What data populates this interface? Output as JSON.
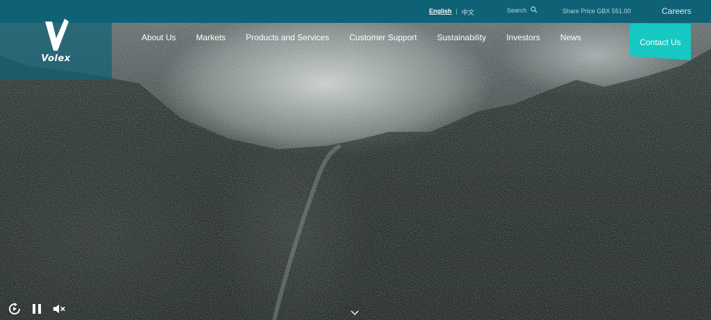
{
  "brand": {
    "name": "Volex"
  },
  "topbar": {
    "lang_active": "English",
    "lang_sep": "|",
    "lang_alt": "中文",
    "search_label": "Search",
    "share_price": "Share Price GBX 551.00",
    "careers": "Careers"
  },
  "nav": {
    "items": [
      "About Us",
      "Markets",
      "Products and Services",
      "Customer Support",
      "Sustainability",
      "Investors",
      "News"
    ],
    "contact": "Contact Us"
  },
  "colors": {
    "topbar": "#0f6276",
    "accent": "#17c7c1"
  },
  "icons": {
    "search": "search-icon",
    "replay": "replay-icon",
    "pause": "pause-icon",
    "mute": "mute-icon",
    "scroll": "chevron-down-icon"
  }
}
